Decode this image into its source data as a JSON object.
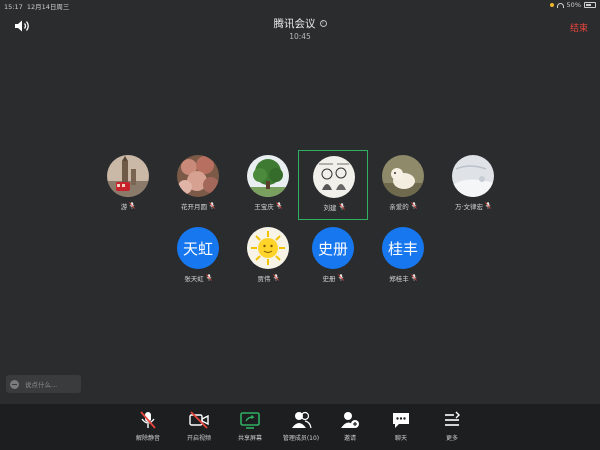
{
  "status_bar": {
    "time": "15:17",
    "date": "12月14日周三",
    "battery": "50%",
    "battery_level": 0.5
  },
  "header": {
    "title": "腾讯会议",
    "timer": "10:45",
    "end_label": "结束"
  },
  "participants": [
    {
      "name": "游",
      "avatar_type": "london-photo",
      "active": false
    },
    {
      "name": "花开月圆",
      "avatar_type": "flowers-photo",
      "active": false
    },
    {
      "name": "王宝庆",
      "avatar_type": "tree-photo",
      "active": false
    },
    {
      "name": "刘建",
      "avatar_type": "sketch-photo",
      "active": true
    },
    {
      "name": "亲爱的",
      "avatar_type": "dog-photo",
      "active": false
    },
    {
      "name": "万·文律宏",
      "avatar_type": "snow-photo",
      "active": false
    },
    {
      "name": "张天虹",
      "avatar_type": "text",
      "avatar_text": "天虹",
      "active": false
    },
    {
      "name": "贾伟",
      "avatar_type": "sun-photo",
      "active": false
    },
    {
      "name": "史册",
      "avatar_type": "text",
      "avatar_text": "史册",
      "active": false
    },
    {
      "name": "郑桂丰",
      "avatar_type": "text",
      "avatar_text": "桂丰",
      "active": false
    }
  ],
  "chat": {
    "placeholder": "说点什么..."
  },
  "toolbar": {
    "items": [
      {
        "label": "解除静音",
        "icon": "mic-off-icon"
      },
      {
        "label": "开启视频",
        "icon": "video-off-icon"
      },
      {
        "label": "共享屏幕",
        "icon": "share-screen-icon"
      },
      {
        "label": "管理成员(10)",
        "icon": "members-icon"
      },
      {
        "label": "邀请",
        "icon": "invite-icon"
      },
      {
        "label": "聊天",
        "icon": "chat-icon"
      },
      {
        "label": "更多",
        "icon": "more-icon"
      }
    ]
  },
  "colors": {
    "background": "#2b2c2e",
    "toolbar": "#1d1e20",
    "accent_blue": "#1677ef",
    "active_green": "#2fb063",
    "end_red": "#e8453c",
    "muted_red": "#e8453c",
    "share_green": "#2fb063"
  }
}
